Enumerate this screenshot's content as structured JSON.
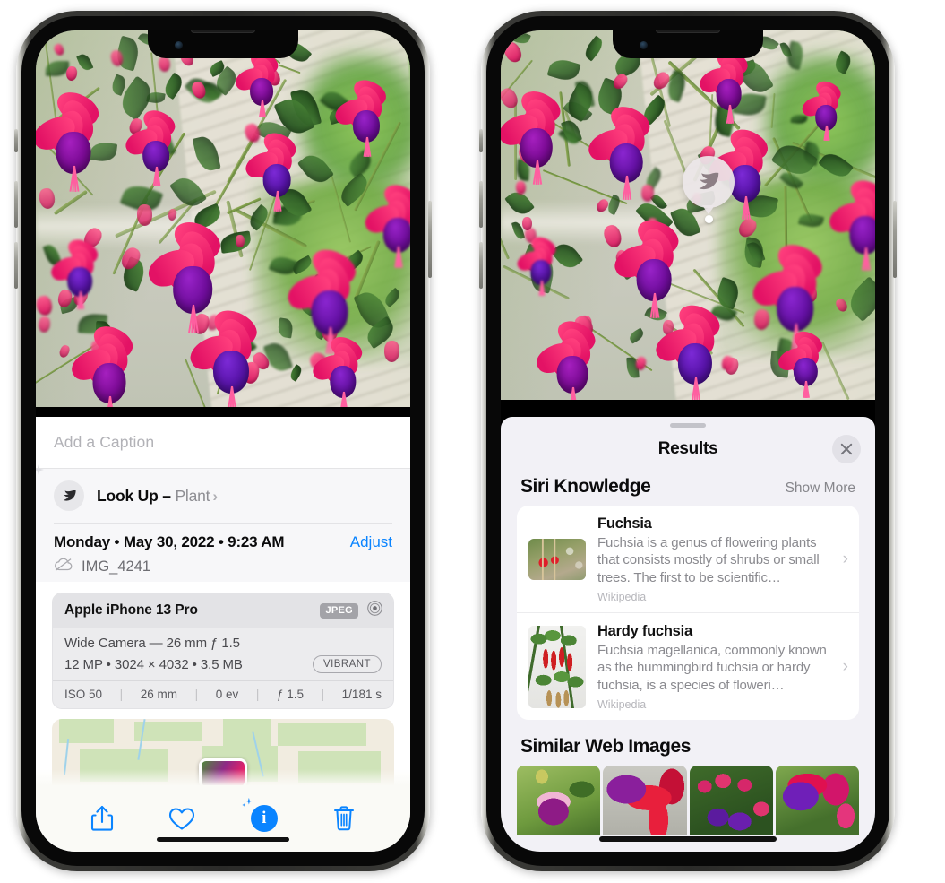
{
  "left_phone": {
    "caption_field": {
      "placeholder": "Add a Caption",
      "value": ""
    },
    "lookup": {
      "icon": "leaf-icon",
      "sparkle_icon": "sparkle-icon",
      "label": "Look Up – ",
      "subject": "Plant",
      "chevron": "›"
    },
    "metadata": {
      "date": "Monday • May 30, 2022 • 9:23 AM",
      "adjust_label": "Adjust",
      "cloud_icon": "icloud-slash-icon",
      "filename": "IMG_4241"
    },
    "camera_card": {
      "model": "Apple iPhone 13 Pro",
      "format_chip": "JPEG",
      "raw_icon": "aperture-icon",
      "lens": "Wide Camera — 26 mm ƒ 1.5",
      "specs": "12 MP • 3024 × 4032 • 3.5 MB",
      "style_chip": "VIBRANT",
      "exif": [
        "ISO 50",
        "26 mm",
        "0 ev",
        "ƒ 1.5",
        "1/181 s"
      ]
    },
    "map": {
      "name": "location-map",
      "pin": "photo-thumbnail-pin"
    },
    "toolbar": [
      {
        "name": "share-button",
        "icon": "share-icon"
      },
      {
        "name": "favorite-button",
        "icon": "heart-icon"
      },
      {
        "name": "info-button",
        "icon": "info-sparkle-icon",
        "glyph": "i"
      },
      {
        "name": "delete-button",
        "icon": "trash-icon"
      }
    ]
  },
  "right_phone": {
    "photo_badge": {
      "icon": "leaf-icon",
      "name": "visual-lookup-badge"
    },
    "sheet": {
      "grabber": "drag-handle",
      "title": "Results",
      "close_icon": "close-icon"
    },
    "siri_knowledge": {
      "title": "Siri Knowledge",
      "show_more": "Show More",
      "items": [
        {
          "title": "Fuchsia",
          "description": "Fuchsia is a genus of flowering plants that consists mostly of shrubs or small trees. The first to be scientific…",
          "source": "Wikipedia",
          "chevron": "›"
        },
        {
          "title": "Hardy fuchsia",
          "description": "Fuchsia magellanica, commonly known as the hummingbird fuchsia or hardy fuchsia, is a species of floweri…",
          "source": "Wikipedia",
          "chevron": "›"
        }
      ]
    },
    "similar_web_images": {
      "title": "Similar Web Images",
      "count": 4
    }
  },
  "colors": {
    "accent_blue": "#0A84FF",
    "sheet_bg": "#F2F1F6",
    "card_bg": "#FFFFFF",
    "secondary_text": "#8A8A8F",
    "panel_grey": "#F7F7F9",
    "camera_card_bg": "#ECECEE"
  }
}
